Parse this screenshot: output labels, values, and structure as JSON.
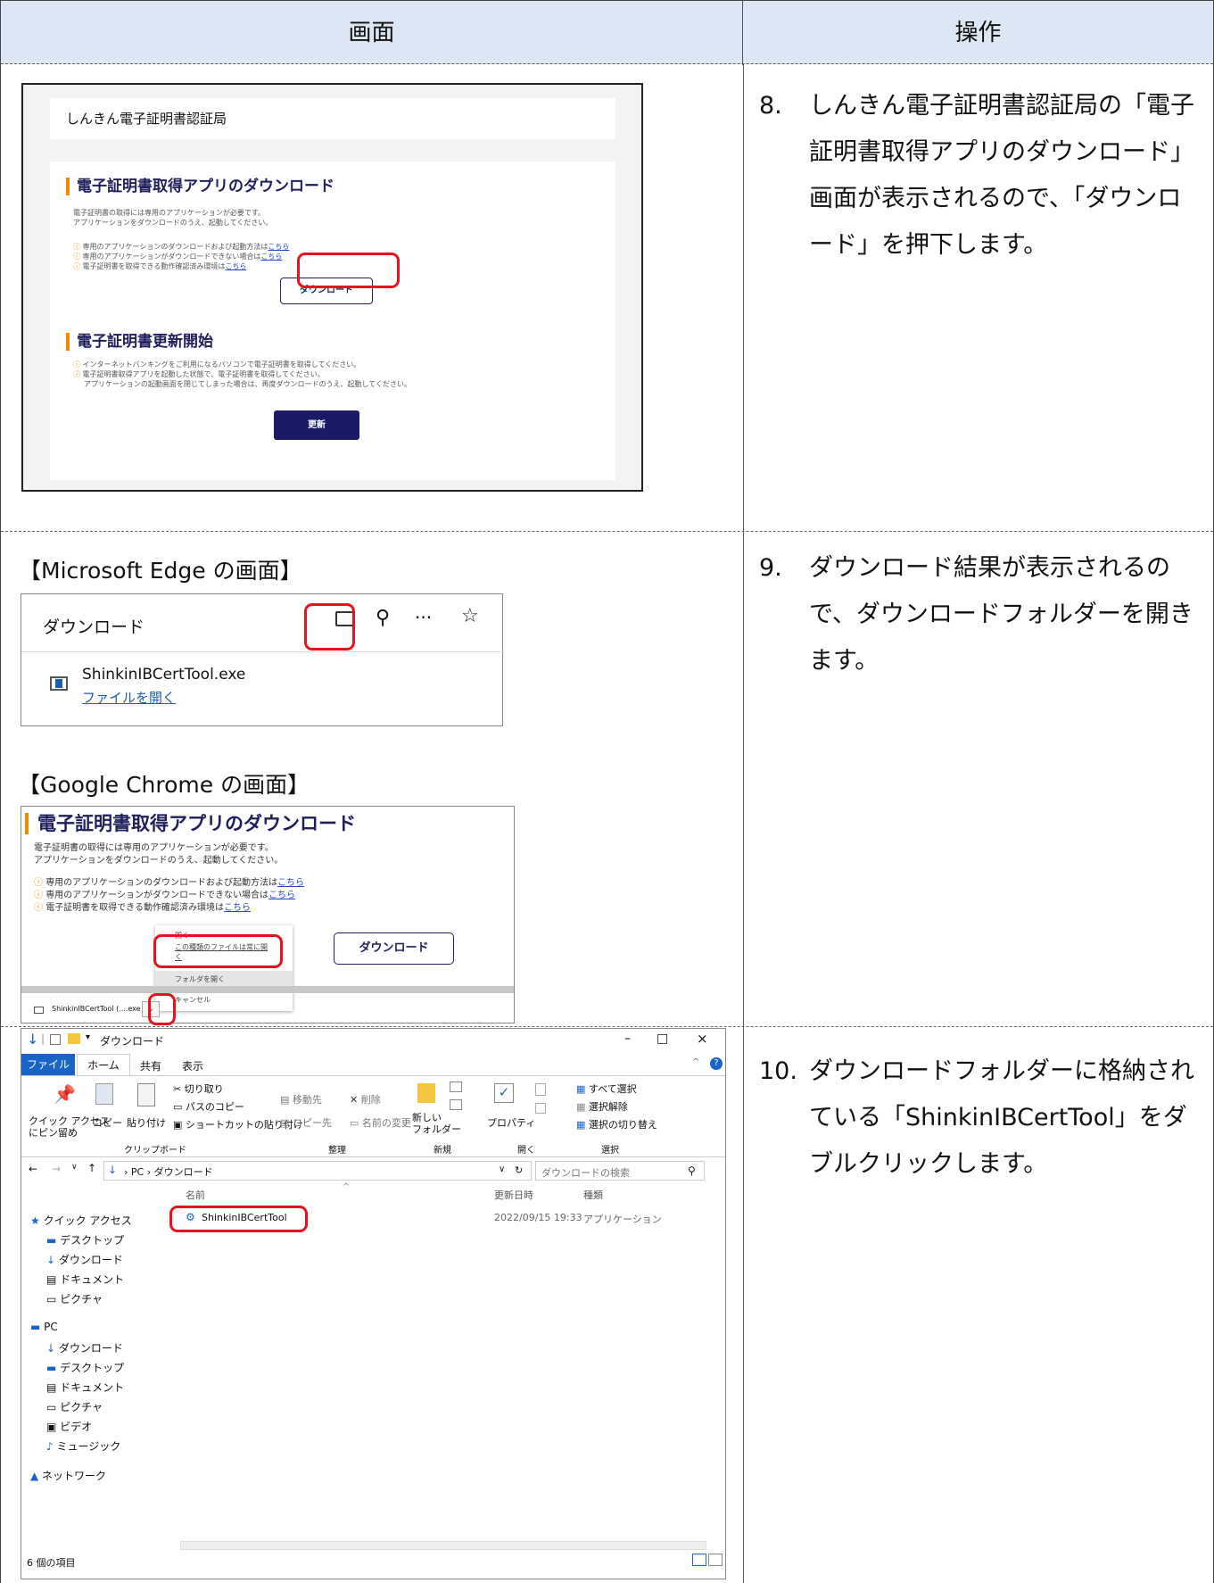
{
  "header": {
    "col_screen": "画面",
    "col_operation": "操作"
  },
  "steps": [
    {
      "num": "8.",
      "text": "しんきん電子証明書認証局の「電子証明書取得アプリのダウンロード」画面が表示されるので、「ダウンロード」を押下します。"
    },
    {
      "num": "9.",
      "text": "ダウンロード結果が表示されるので、ダウンロードフォルダーを開きます。"
    },
    {
      "num": "10.",
      "text": "ダウンロードフォルダーに格納されている「ShinkinIBCertTool」をダブルクリックします。"
    }
  ],
  "screen1": {
    "site_title": "しんきん電子証明書認証局",
    "section1_title": "電子証明書取得アプリのダウンロード",
    "intro_line1": "電子証明書の取得には専用のアプリケーションが必要です。",
    "intro_line2": "アプリケーションをダウンロードのうえ、起動してください。",
    "note1": "専用のアプリケーションのダウンロードおよび起動方法は",
    "note2": "専用のアプリケーションがダウンロードできない場合は",
    "note3": "電子証明書を取得できる動作確認済み環境は",
    "link": "こちら",
    "download_button": "ダウンロード",
    "section2_title": "電子証明書更新開始",
    "renew_note1": "インターネットバンキングをご利用になるパソコンで電子証明書を取得してください。",
    "renew_note2": "電子証明書取得アプリを起動した状態で、電子証明書を取得してください。",
    "renew_note3": "アプリケーションの起動画面を閉じてしまった場合は、再度ダウンロードのうえ、起動してください。",
    "update_button": "更新"
  },
  "edge": {
    "label": "【Microsoft Edge の画面】",
    "panel_title": "ダウンロード",
    "file_name": "ShinkinIBCertTool.exe",
    "open_file": "ファイルを開く",
    "more_glyph": "···"
  },
  "chrome": {
    "label": "【Google Chrome の画面】",
    "title": "電子証明書取得アプリのダウンロード",
    "intro_line1": "電子証明書の取得には専用のアプリケーションが必要です。",
    "intro_line2": "アプリケーションをダウンロードのうえ、起動してください。",
    "note1": "専用のアプリケーションのダウンロードおよび起動方法は",
    "note2": "専用のアプリケーションがダウンロードできない場合は",
    "note3": "電子証明書を取得できる動作確認済み環境は",
    "link": "こちら",
    "download_button": "ダウンロード",
    "menu": [
      "開く",
      "この種類のファイルは常に開く",
      "フォルダを開く",
      "キャンセル"
    ],
    "download_item": "ShinkinIBCertTool (....exe"
  },
  "explorer": {
    "window_title": "ダウンロード",
    "ribbon_tabs": [
      "ファイル",
      "ホーム",
      "共有",
      "表示"
    ],
    "ribbon": {
      "cut": "切り取り",
      "copy_path": "パスのコピー",
      "paste_shortcut": "ショートカットの貼り付け",
      "pin": "クイック アクセス\nにピン留め",
      "copy": "コピー",
      "paste": "貼り付け",
      "move_to": "移動先",
      "delete": "削除",
      "copy_to": "コピー先",
      "rename": "名前の変更",
      "new_folder": "新しい\nフォルダー",
      "properties": "プロパティ",
      "select_all": "すべて選択",
      "select_none": "選択解除",
      "invert": "選択の切り替え",
      "groups": [
        "クリップボード",
        "整理",
        "新規",
        "開く",
        "選択"
      ]
    },
    "address": [
      "PC",
      "ダウンロード"
    ],
    "search_placeholder": "ダウンロードの検索",
    "columns": [
      "名前",
      "更新日時",
      "種類"
    ],
    "file": {
      "name": "ShinkinIBCertTool",
      "date": "2022/09/15 19:33",
      "type": "アプリケーション"
    },
    "nav": {
      "quick": "クイック アクセス",
      "quick_items": [
        "デスクトップ",
        "ダウンロード",
        "ドキュメント",
        "ピクチャ"
      ],
      "pc": "PC",
      "pc_items": [
        "ダウンロード",
        "デスクトップ",
        "ドキュメント",
        "ピクチャ",
        "ビデオ",
        "ミュージック"
      ],
      "network": "ネットワーク"
    },
    "status": "6 個の項目"
  },
  "colors": {
    "accent_red": "#e8111e",
    "navy": "#1f1f5c",
    "header_bg": "#dde6f3"
  }
}
